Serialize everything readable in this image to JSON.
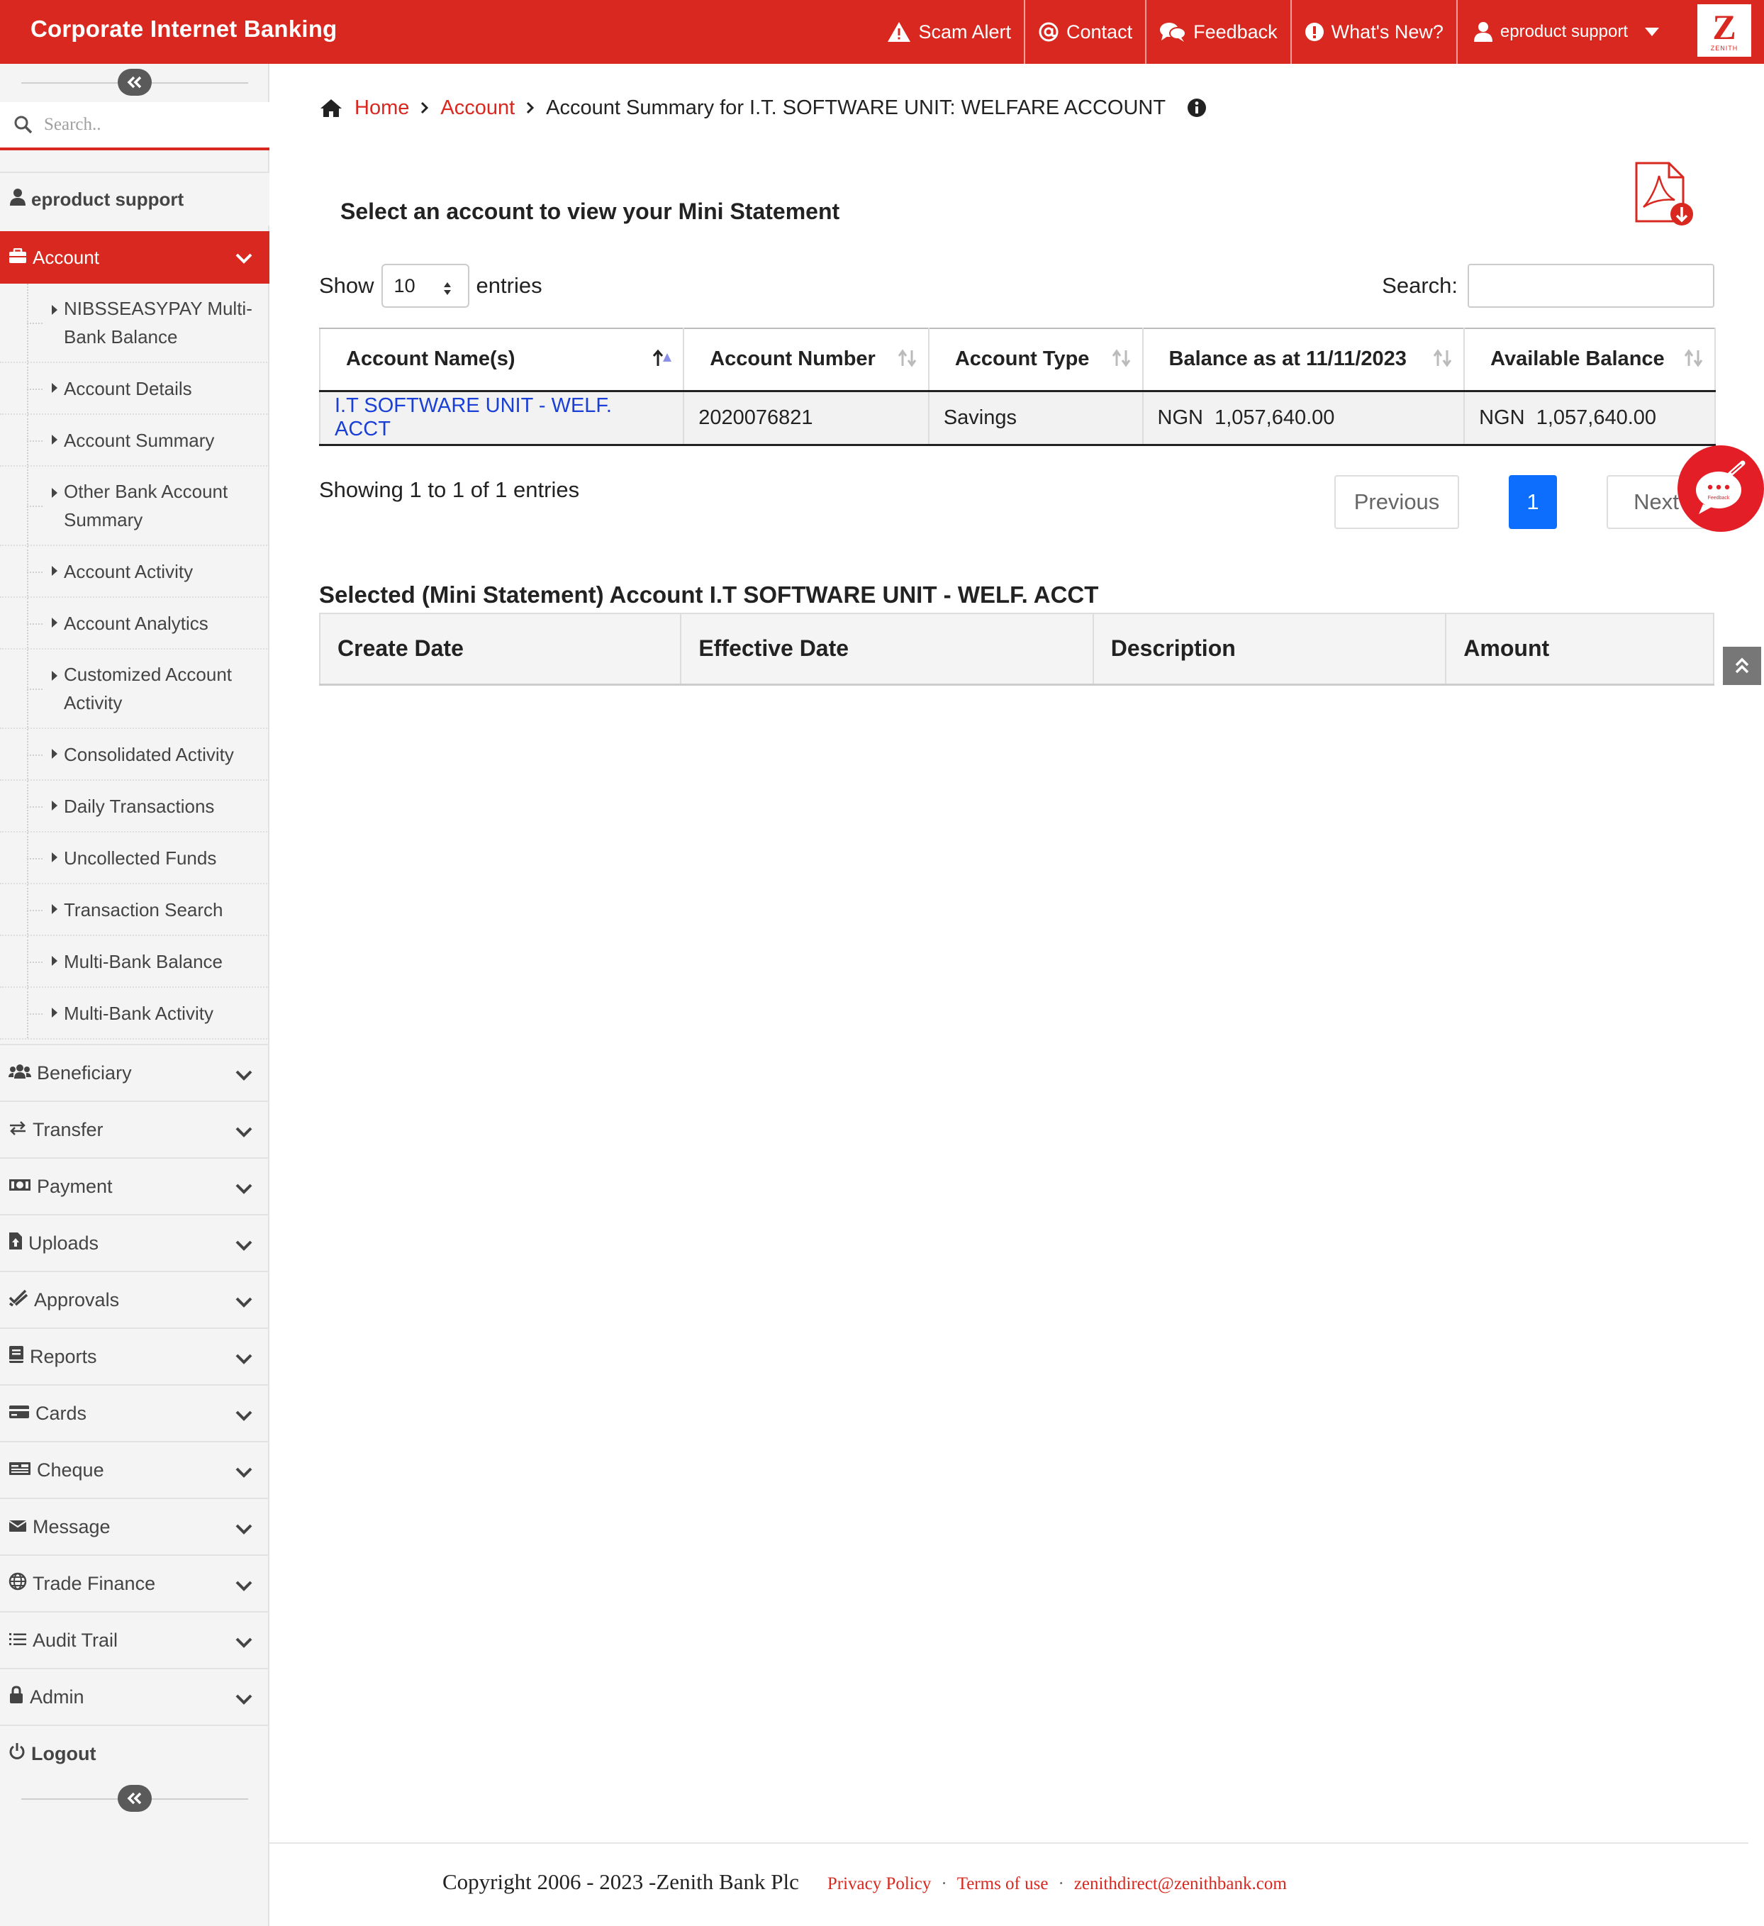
{
  "header": {
    "brand": "Corporate Internet Banking",
    "nav": [
      {
        "label": "Scam Alert",
        "icon": "warning-icon"
      },
      {
        "label": "Contact",
        "icon": "at-icon"
      },
      {
        "label": "Feedback",
        "icon": "comments-icon"
      },
      {
        "label": "What's New?",
        "icon": "exclamation-circle-icon"
      }
    ],
    "user": "eproduct support",
    "logo_letter": "Z",
    "logo_text": "ZENITH"
  },
  "sidebar": {
    "search_placeholder": "Search..",
    "user_name": "eproduct support",
    "active_section": "Account",
    "account_items": [
      {
        "label": "NIBSSEASYPAY Multi-Bank Balance"
      },
      {
        "label": "Account Details"
      },
      {
        "label": "Account Summary"
      },
      {
        "label": "Other Bank Account Summary"
      },
      {
        "label": "Account Activity"
      },
      {
        "label": "Account Analytics"
      },
      {
        "label": "Customized Account Activity"
      },
      {
        "label": "Consolidated Activity"
      },
      {
        "label": "Daily Transactions"
      },
      {
        "label": "Uncollected Funds"
      },
      {
        "label": "Transaction Search"
      },
      {
        "label": "Multi-Bank Balance"
      },
      {
        "label": "Multi-Bank Activity"
      }
    ],
    "menu": [
      {
        "label": "Beneficiary",
        "icon": "users-icon"
      },
      {
        "label": "Transfer",
        "icon": "exchange-icon"
      },
      {
        "label": "Payment",
        "icon": "money-icon"
      },
      {
        "label": "Uploads",
        "icon": "file-upload-icon"
      },
      {
        "label": "Approvals",
        "icon": "check-double-icon"
      },
      {
        "label": "Reports",
        "icon": "book-icon"
      },
      {
        "label": "Cards",
        "icon": "credit-card-icon"
      },
      {
        "label": "Cheque",
        "icon": "cheque-icon"
      },
      {
        "label": "Message",
        "icon": "envelope-icon"
      },
      {
        "label": "Trade Finance",
        "icon": "globe-icon"
      },
      {
        "label": "Audit Trail",
        "icon": "list-icon"
      },
      {
        "label": "Admin",
        "icon": "lock-icon"
      }
    ],
    "logout": "Logout"
  },
  "breadcrumb": {
    "home": "Home",
    "account": "Account",
    "current": "Account Summary for I.T. SOFTWARE UNIT: WELFARE ACCOUNT"
  },
  "main": {
    "title": "Select an account to view your Mini Statement",
    "show_label": "Show",
    "entries_value": "10",
    "entries_label": "entries",
    "search_label": "Search:",
    "search_value": "",
    "columns": [
      "Account Name(s)",
      "Account Number",
      "Account Type",
      "Balance as at 11/11/2023",
      "Available Balance"
    ],
    "rows": [
      {
        "name": "I.T SOFTWARE UNIT - WELF. ACCT",
        "number": "2020076821",
        "type": "Savings",
        "balance_currency": "NGN",
        "balance": "1,057,640.00",
        "available_currency": "NGN",
        "available": "1,057,640.00"
      }
    ],
    "info": "Showing 1 to 1 of 1 entries",
    "pagination": {
      "previous": "Previous",
      "current_page": "1",
      "next": "Next"
    },
    "feedback_badge_text": "Feedback",
    "mini_title": "Selected (Mini Statement) Account I.T SOFTWARE UNIT - WELF. ACCT",
    "mini_columns": [
      "Create Date",
      "Effective Date",
      "Description",
      "Amount"
    ]
  },
  "footer": {
    "copyright": "Copyright 2006 - 2023 -Zenith Bank Plc",
    "privacy": "Privacy Policy",
    "terms": "Terms of use",
    "email": "zenithdirect@zenithbank.com"
  },
  "colors": {
    "brand_red": "#d8281f",
    "link_blue": "#1a3fd6",
    "page_active": "#0d6efd"
  }
}
